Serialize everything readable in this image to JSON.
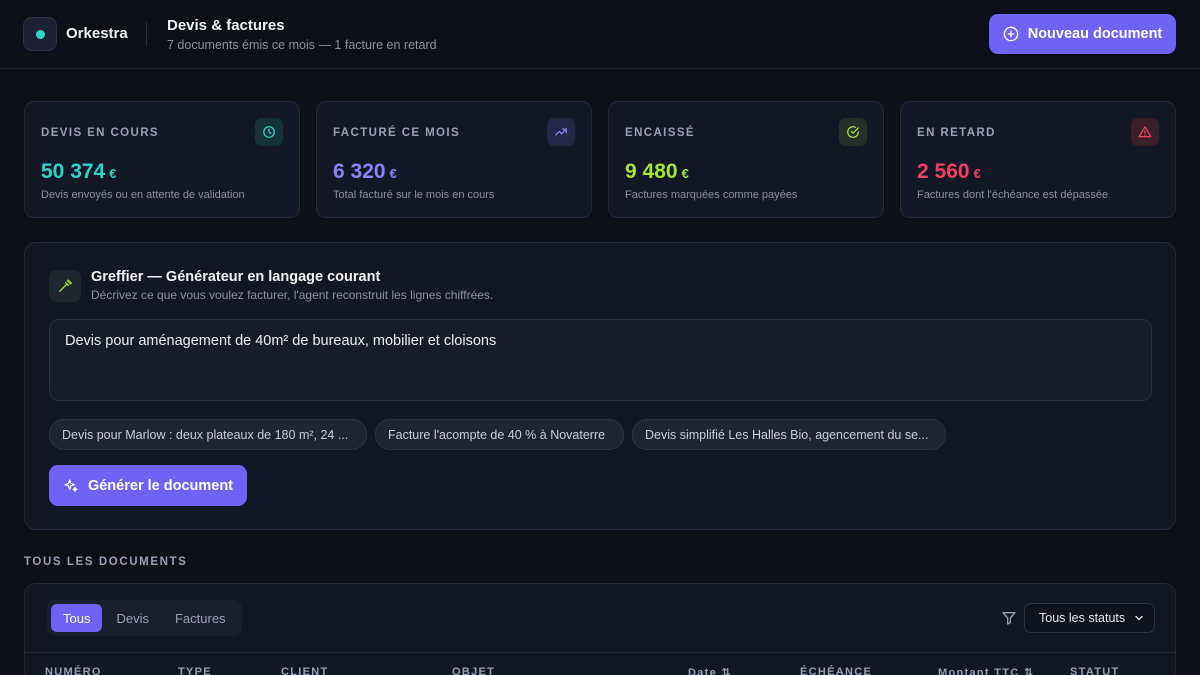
{
  "app": {
    "name": "Orkestra"
  },
  "header": {
    "title": "Devis & factures",
    "subtitle": "7 documents émis ce mois — 1 facture en retard",
    "new_button_label": "Nouveau document"
  },
  "stats": [
    {
      "label": "DEVIS EN COURS",
      "value": "50 374",
      "currency": "€",
      "description": "Devis envoyés ou en attente de validation",
      "color": "#2ed3c9",
      "icon": "clock-icon"
    },
    {
      "label": "FACTURÉ CE MOIS",
      "value": "6 320",
      "currency": "€",
      "description": "Total facturé sur le mois en cours",
      "color": "#8b82ff",
      "icon": "trending-up-icon"
    },
    {
      "label": "ENCAISSÉ",
      "value": "9 480",
      "currency": "€",
      "description": "Factures marquées comme payées",
      "color": "#a3e635",
      "icon": "check-circle-icon"
    },
    {
      "label": "EN RETARD",
      "value": "2 560",
      "currency": "€",
      "description": "Factures dont l'échéance est dépassée",
      "color": "#f43f5e",
      "icon": "alert-triangle-icon"
    }
  ],
  "generator": {
    "title": "Greffier — Générateur en langage courant",
    "subtitle": "Décrivez ce que vous voulez facturer, l'agent reconstruit les lignes chiffrées.",
    "input_value": "Devis pour aménagement de 40m² de bureaux, mobilier et cloisons",
    "suggestions": [
      "Devis pour Marlow : deux plateaux de 180 m², 24 ...",
      "Facture l'acompte de 40 % à Novaterre",
      "Devis simplifié Les Halles Bio, agencement du se..."
    ],
    "generate_label": "Générer le document"
  },
  "documents": {
    "section_title": "TOUS LES DOCUMENTS",
    "tabs": [
      "Tous",
      "Devis",
      "Factures"
    ],
    "active_tab": "Tous",
    "status_filter": "Tous les statuts",
    "columns": [
      "NUMÉRO",
      "TYPE",
      "CLIENT",
      "OBJET",
      "Date ⇅",
      "ÉCHÉANCE",
      "Montant TTC ⇅",
      "STATUT"
    ]
  },
  "colors": {
    "accent": "#6f63f5",
    "background": "#0c0f18",
    "card": "#131826"
  }
}
